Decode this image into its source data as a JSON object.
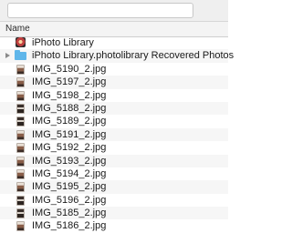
{
  "header": {
    "name_column": "Name"
  },
  "items": [
    {
      "label": "iPhoto Library",
      "icon": "iphoto-library-icon",
      "kind": "photo-app",
      "disclosure": false
    },
    {
      "label": "iPhoto Library.photolibrary Recovered Photos",
      "icon": "folder-icon",
      "kind": "folder",
      "disclosure": true
    },
    {
      "label": "IMG_5190_2.jpg",
      "icon": "jpg-thumbnail-icon",
      "kind": "jpg"
    },
    {
      "label": "IMG_5197_2.jpg",
      "icon": "jpg-thumbnail-icon",
      "kind": "jpg"
    },
    {
      "label": "IMG_5198_2.jpg",
      "icon": "jpg-thumbnail-icon",
      "kind": "jpg"
    },
    {
      "label": "IMG_5188_2.jpg",
      "icon": "jpg-thumbnail-icon",
      "kind": "jpg dark"
    },
    {
      "label": "IMG_5189_2.jpg",
      "icon": "jpg-thumbnail-icon",
      "kind": "jpg dark"
    },
    {
      "label": "IMG_5191_2.jpg",
      "icon": "jpg-thumbnail-icon",
      "kind": "jpg"
    },
    {
      "label": "IMG_5192_2.jpg",
      "icon": "jpg-thumbnail-icon",
      "kind": "jpg"
    },
    {
      "label": "IMG_5193_2.jpg",
      "icon": "jpg-thumbnail-icon",
      "kind": "jpg"
    },
    {
      "label": "IMG_5194_2.jpg",
      "icon": "jpg-thumbnail-icon",
      "kind": "jpg"
    },
    {
      "label": "IMG_5195_2.jpg",
      "icon": "jpg-thumbnail-icon",
      "kind": "jpg"
    },
    {
      "label": "IMG_5196_2.jpg",
      "icon": "jpg-thumbnail-icon",
      "kind": "jpg dark"
    },
    {
      "label": "IMG_5185_2.jpg",
      "icon": "jpg-thumbnail-icon",
      "kind": "jpg dark"
    },
    {
      "label": "IMG_5186_2.jpg",
      "icon": "jpg-thumbnail-icon",
      "kind": "jpg"
    }
  ]
}
